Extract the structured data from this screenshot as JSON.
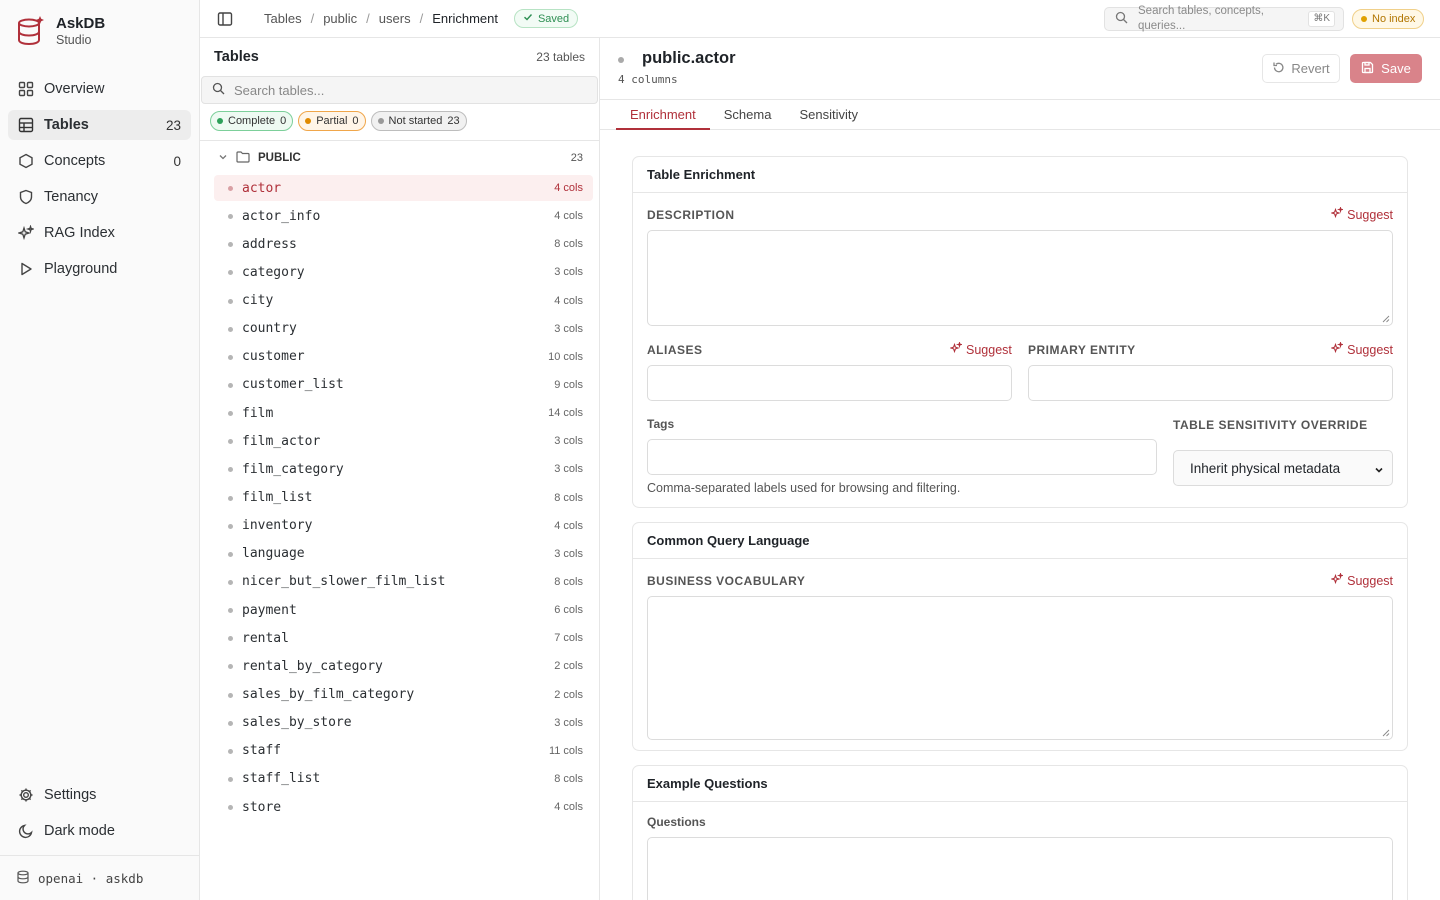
{
  "brand": {
    "title": "AskDB",
    "subtitle": "Studio"
  },
  "nav": {
    "items": [
      {
        "label": "Overview",
        "icon": "grid-icon",
        "count": ""
      },
      {
        "label": "Tables",
        "icon": "table-icon",
        "count": "23",
        "active": true
      },
      {
        "label": "Concepts",
        "icon": "hexagon-icon",
        "count": "0"
      },
      {
        "label": "Tenancy",
        "icon": "shield-icon",
        "count": ""
      },
      {
        "label": "RAG Index",
        "icon": "sparkles-icon",
        "count": ""
      },
      {
        "label": "Playground",
        "icon": "play-icon",
        "count": ""
      }
    ],
    "bottom": [
      {
        "label": "Settings",
        "icon": "gear-icon"
      },
      {
        "label": "Dark mode",
        "icon": "moon-icon"
      }
    ],
    "footer": "openai · askdb"
  },
  "topbar": {
    "breadcrumbs": [
      "Tables",
      "public",
      "users",
      "Enrichment"
    ],
    "saved_badge": "Saved",
    "search_placeholder": "Search tables, concepts, queries...",
    "shortcut": "⌘K",
    "index_status": "No index"
  },
  "tables_panel": {
    "title": "Tables",
    "count_label": "23 tables",
    "search_placeholder": "Search tables...",
    "filters": {
      "complete": {
        "label": "Complete",
        "count": "0"
      },
      "partial": {
        "label": "Partial",
        "count": "0"
      },
      "not_started": {
        "label": "Not started",
        "count": "23"
      }
    },
    "group": {
      "name": "PUBLIC",
      "count": "23"
    },
    "tables": [
      {
        "name": "actor",
        "cols": "4 cols",
        "active": true
      },
      {
        "name": "actor_info",
        "cols": "4 cols"
      },
      {
        "name": "address",
        "cols": "8 cols"
      },
      {
        "name": "category",
        "cols": "3 cols"
      },
      {
        "name": "city",
        "cols": "4 cols"
      },
      {
        "name": "country",
        "cols": "3 cols"
      },
      {
        "name": "customer",
        "cols": "10 cols"
      },
      {
        "name": "customer_list",
        "cols": "9 cols"
      },
      {
        "name": "film",
        "cols": "14 cols"
      },
      {
        "name": "film_actor",
        "cols": "3 cols"
      },
      {
        "name": "film_category",
        "cols": "3 cols"
      },
      {
        "name": "film_list",
        "cols": "8 cols"
      },
      {
        "name": "inventory",
        "cols": "4 cols"
      },
      {
        "name": "language",
        "cols": "3 cols"
      },
      {
        "name": "nicer_but_slower_film_list",
        "cols": "8 cols"
      },
      {
        "name": "payment",
        "cols": "6 cols"
      },
      {
        "name": "rental",
        "cols": "7 cols"
      },
      {
        "name": "rental_by_category",
        "cols": "2 cols"
      },
      {
        "name": "sales_by_film_category",
        "cols": "2 cols"
      },
      {
        "name": "sales_by_store",
        "cols": "3 cols"
      },
      {
        "name": "staff",
        "cols": "11 cols"
      },
      {
        "name": "staff_list",
        "cols": "8 cols"
      },
      {
        "name": "store",
        "cols": "4 cols"
      }
    ]
  },
  "main": {
    "title": "public.actor",
    "subtitle": "4 columns",
    "revert_label": "Revert",
    "save_label": "Save",
    "tabs": [
      "Enrichment",
      "Schema",
      "Sensitivity"
    ],
    "active_tab": "Enrichment",
    "enrichment_card": {
      "title": "Table Enrichment",
      "description_label": "DESCRIPTION",
      "aliases_label": "ALIASES",
      "primary_entity_label": "PRIMARY ENTITY",
      "tags_label": "Tags",
      "tags_hint": "Comma-separated labels used for browsing and filtering.",
      "sensitivity_label": "TABLE SENSITIVITY OVERRIDE",
      "sensitivity_value": "Inherit physical metadata",
      "suggest_label": "Suggest"
    },
    "cql_card": {
      "title": "Common Query Language",
      "vocab_label": "BUSINESS VOCABULARY",
      "suggest_label": "Suggest"
    },
    "examples_card": {
      "title": "Example Questions",
      "questions_label": "Questions"
    }
  },
  "colors": {
    "accent": "#b0303a",
    "save_button": "#d9838a",
    "saved_green": "#2e8f53",
    "warning": "#b27600"
  }
}
